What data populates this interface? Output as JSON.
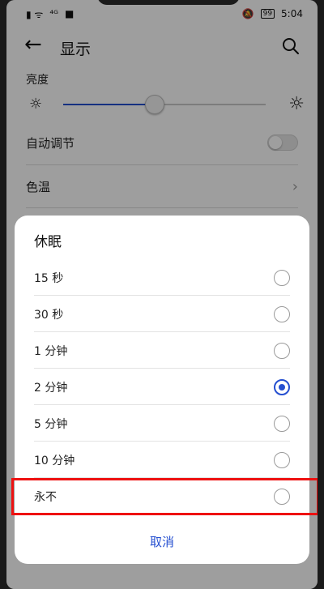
{
  "status_bar": {
    "signal": "▮ ᯤ",
    "carrier": "⁴ᴳ",
    "time": "5:04",
    "battery": "99"
  },
  "app_bar": {
    "back_icon": "←",
    "title": "显示",
    "search_icon": "search-icon"
  },
  "brightness": {
    "label": "亮度",
    "level_fraction": 0.45,
    "accent": "#254fd0"
  },
  "auto_adjust": {
    "label": "自动调节",
    "enabled": false
  },
  "color_temp": {
    "label": "色温",
    "chevron": "›"
  },
  "dialog": {
    "title": "休眠",
    "options": [
      {
        "label": "15 秒",
        "selected": false
      },
      {
        "label": "30 秒",
        "selected": false
      },
      {
        "label": "1 分钟",
        "selected": false
      },
      {
        "label": "2 分钟",
        "selected": true
      },
      {
        "label": "5 分钟",
        "selected": false
      },
      {
        "label": "10 分钟",
        "selected": false
      },
      {
        "label": "永不",
        "selected": false
      }
    ],
    "cancel_label": "取消",
    "highlight_color": "#ee1111"
  }
}
